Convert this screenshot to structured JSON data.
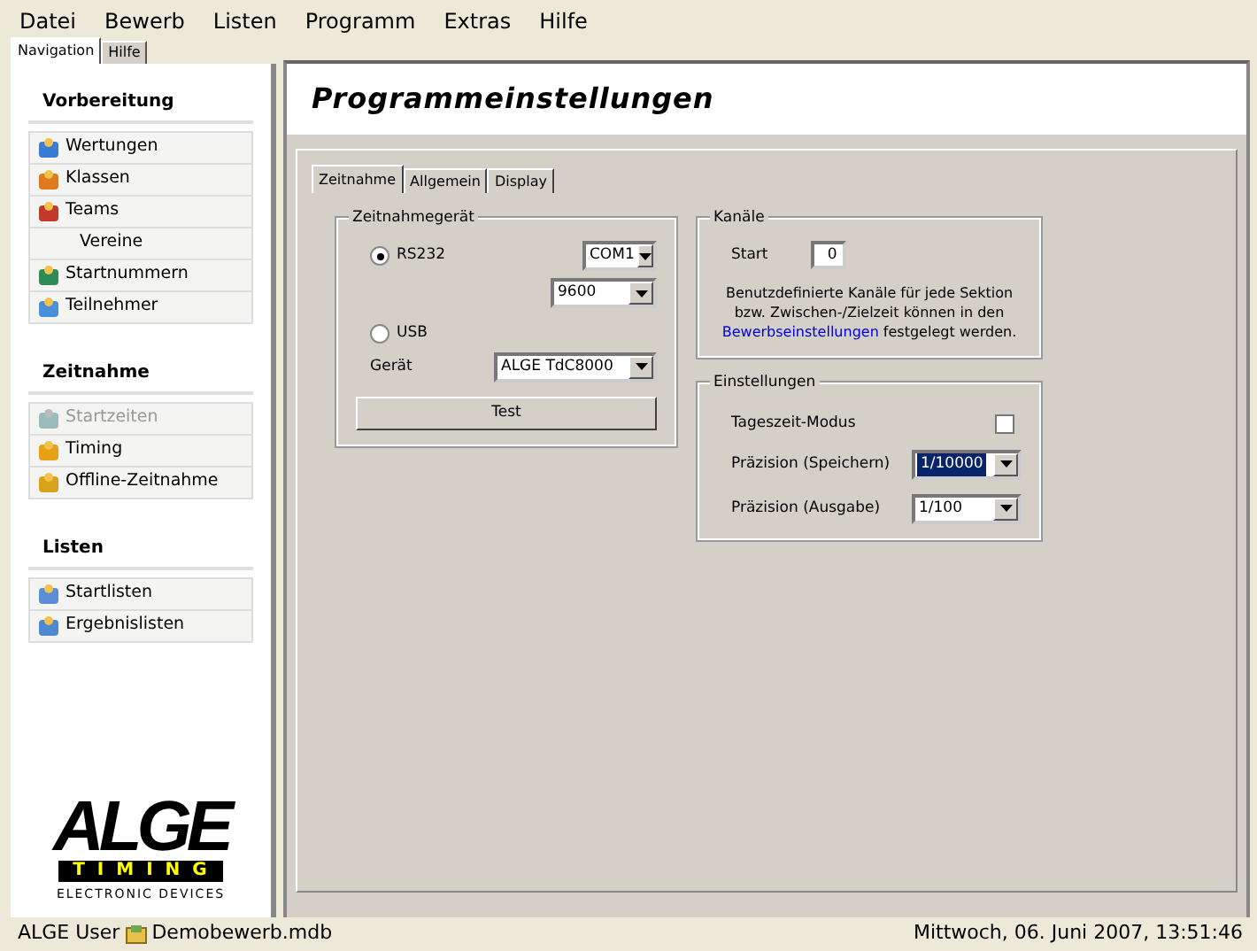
{
  "menu": [
    "Datei",
    "Bewerb",
    "Listen",
    "Programm",
    "Extras",
    "Hilfe"
  ],
  "nav_tabs": [
    {
      "label": "Navigation",
      "selected": true
    },
    {
      "label": "Hilfe",
      "selected": false
    }
  ],
  "sidebar": [
    {
      "title": "Vorbereitung",
      "items": [
        {
          "label": "Wertungen",
          "kind": "icon",
          "disabled": false
        },
        {
          "label": "Klassen",
          "kind": "icon",
          "disabled": false
        },
        {
          "label": "Teams",
          "kind": "icon",
          "disabled": false
        },
        {
          "label": "Vereine",
          "kind": "plain",
          "disabled": false
        },
        {
          "label": "Startnummern",
          "kind": "icon",
          "disabled": false
        },
        {
          "label": "Teilnehmer",
          "kind": "icon",
          "disabled": false
        }
      ]
    },
    {
      "title": "Zeitnahme",
      "items": [
        {
          "label": "Startzeiten",
          "kind": "icon",
          "disabled": true
        },
        {
          "label": "Timing",
          "kind": "icon",
          "disabled": false
        },
        {
          "label": "Offline-Zeitnahme",
          "kind": "icon",
          "disabled": false
        }
      ]
    },
    {
      "title": "Listen",
      "items": [
        {
          "label": "Startlisten",
          "kind": "icon",
          "disabled": false
        },
        {
          "label": "Ergebnislisten",
          "kind": "icon",
          "disabled": false
        }
      ]
    }
  ],
  "logo": {
    "name": "ALGE",
    "band": "TIMING",
    "tagline": "ELECTRONIC DEVICES"
  },
  "title": "Programmeinstellungen",
  "tabs": [
    {
      "label": "Zeitnahme",
      "selected": true
    },
    {
      "label": "Allgemein",
      "selected": false
    },
    {
      "label": "Display",
      "selected": false
    }
  ],
  "device_group": {
    "title": "Zeitnahmegerät",
    "radios": [
      {
        "label": "RS232",
        "selected": true
      },
      {
        "label": "USB",
        "selected": false
      }
    ],
    "port": "COM1",
    "baud": "9600",
    "device_label": "Gerät",
    "device": "ALGE TdC8000",
    "test_button": "Test"
  },
  "channels_group": {
    "title": "Kanäle",
    "start_label": "Start",
    "start_value": "0",
    "note_before": "Benutzdefinierte Kanäle für jede Sektion bzw. Zwischen-/Zielzeit können in den",
    "note_link": "Bewerbseinstellungen",
    "note_after": "festgelegt werden."
  },
  "settings_group": {
    "title": "Einstellungen",
    "daytime_label": "Tageszeit-Modus",
    "daytime_checked": false,
    "selects": [
      {
        "label": "Präzision (Speichern)",
        "value": "1/10000",
        "focused": true
      },
      {
        "label": "Präzision (Ausgabe)",
        "value": "1/100",
        "focused": false
      }
    ]
  },
  "status_bar": {
    "user": "ALGE User",
    "file": "Demobewerb.mdb",
    "datetime": "Mittwoch, 06. Juni 2007, 13:51:46"
  }
}
